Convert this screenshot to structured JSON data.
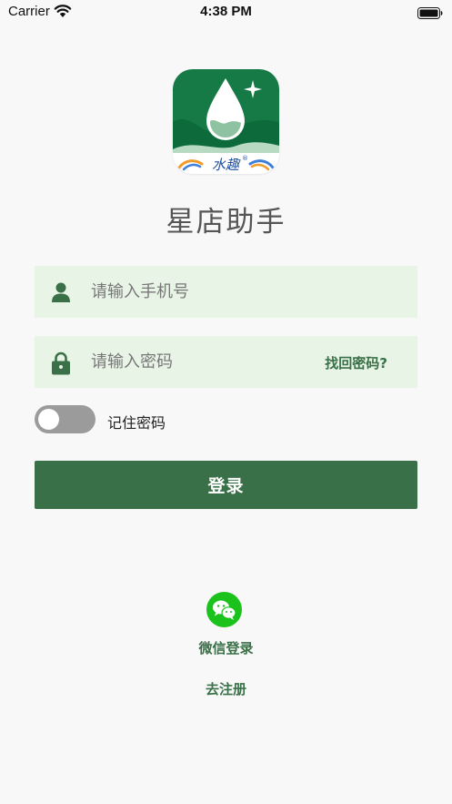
{
  "status_bar": {
    "carrier": "Carrier",
    "time": "4:38 PM"
  },
  "logo": {
    "brand_text": "水趣",
    "registered_mark": "®"
  },
  "app_title": "星店助手",
  "phone_field": {
    "placeholder": "请输入手机号",
    "icon": "user-icon"
  },
  "password_field": {
    "placeholder": "请输入密码",
    "icon": "lock-icon",
    "forgot_label": "找回密码?"
  },
  "remember": {
    "label": "记住密码",
    "checked": false
  },
  "login_button": "登录",
  "wechat": {
    "label": "微信登录",
    "icon": "wechat-icon"
  },
  "register_link": "去注册",
  "colors": {
    "brand_green": "#3a7048",
    "field_bg": "#e8f4e6",
    "wechat_green": "#1bc21b",
    "toggle_off": "#9b9b9b"
  }
}
